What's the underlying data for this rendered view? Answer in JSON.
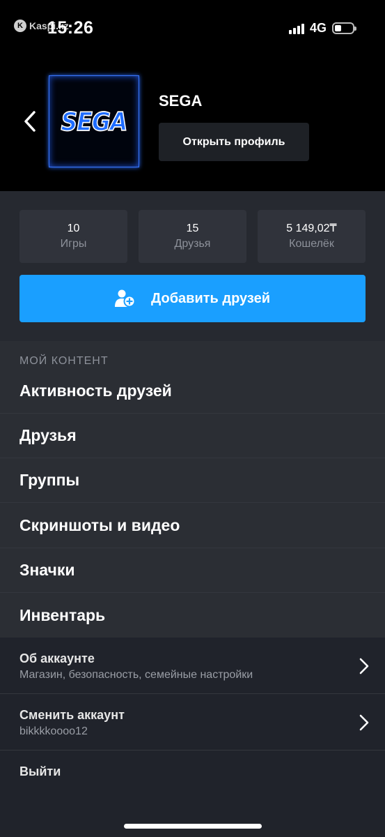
{
  "status_bar": {
    "carrier_app": "Kaspi.kz",
    "time": "15:26",
    "network": "4G"
  },
  "profile": {
    "avatar_text": "SEGA",
    "name": "SEGA",
    "open_profile_label": "Открыть профиль"
  },
  "stats": [
    {
      "value": "10",
      "label": "Игры"
    },
    {
      "value": "15",
      "label": "Друзья"
    },
    {
      "value": "5 149,02₸",
      "label": "Кошелёк"
    }
  ],
  "add_friends_label": "Добавить друзей",
  "my_content": {
    "title": "МОЙ КОНТЕНТ",
    "items": [
      {
        "label": "Активность друзей"
      },
      {
        "label": "Друзья"
      },
      {
        "label": "Группы"
      },
      {
        "label": "Скриншоты и видео"
      },
      {
        "label": "Значки"
      },
      {
        "label": "Инвентарь"
      }
    ]
  },
  "account": {
    "about_title": "Об аккаунте",
    "about_sub": "Магазин, безопасность, семейные настройки",
    "switch_title": "Сменить аккаунт",
    "switch_sub": "bikkkkoooo12",
    "logout_label": "Выйти"
  },
  "colors": {
    "accent": "#1a9fff",
    "background": "#20232b",
    "header_background": "#000000"
  }
}
